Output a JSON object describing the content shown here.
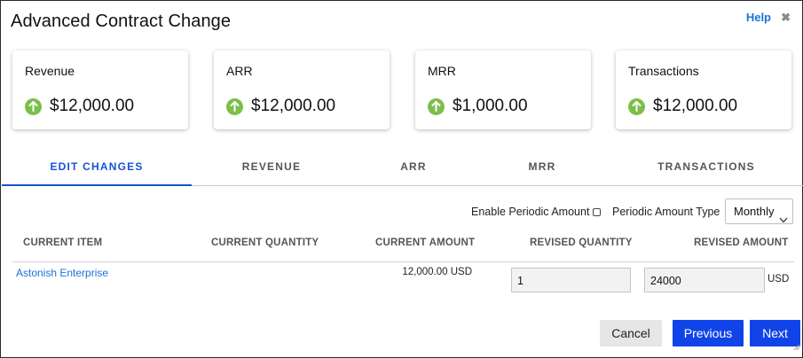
{
  "dialog": {
    "title": "Advanced Contract Change",
    "help_label": "Help",
    "close_glyph": "✖"
  },
  "summary_cards": [
    {
      "label": "Revenue",
      "value": "$12,000.00",
      "icon": "arrow-up-circle-icon"
    },
    {
      "label": "ARR",
      "value": "$12,000.00",
      "icon": "arrow-up-circle-icon"
    },
    {
      "label": "MRR",
      "value": "$1,000.00",
      "icon": "arrow-up-circle-icon"
    },
    {
      "label": "Transactions",
      "value": "$12,000.00",
      "icon": "arrow-up-circle-icon"
    }
  ],
  "tabs": [
    {
      "label": "EDIT CHANGES",
      "active": true
    },
    {
      "label": "REVENUE",
      "active": false
    },
    {
      "label": "ARR",
      "active": false
    },
    {
      "label": "MRR",
      "active": false
    },
    {
      "label": "TRANSACTIONS",
      "active": false
    }
  ],
  "options": {
    "enable_periodic_label": "Enable Periodic Amount",
    "enable_periodic_checked": false,
    "periodic_type_label": "Periodic Amount Type",
    "periodic_type_value": "Monthly"
  },
  "table": {
    "headers": [
      "CURRENT ITEM",
      "CURRENT QUANTITY",
      "CURRENT AMOUNT",
      "REVISED QUANTITY",
      "REVISED AMOUNT"
    ],
    "rows": [
      {
        "current_item": "Astonish Enterprise",
        "current_quantity": "",
        "current_amount": "12,000.00 USD",
        "revised_quantity": "1",
        "revised_amount": "24000",
        "revised_currency": "USD"
      }
    ]
  },
  "footer": {
    "cancel_label": "Cancel",
    "previous_label": "Previous",
    "next_label": "Next"
  },
  "colors": {
    "accent": "#1144e8",
    "link": "#1a73d9",
    "tab_active": "#1553d6",
    "up_arrow": "#7bbf4a"
  }
}
